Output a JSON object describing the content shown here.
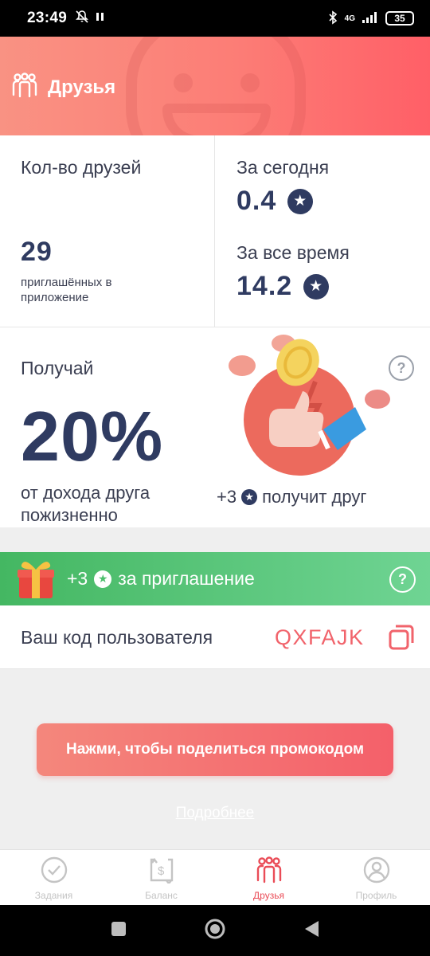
{
  "status_bar": {
    "time": "23:49",
    "network": "4G",
    "battery": "35"
  },
  "header": {
    "title": "Друзья"
  },
  "stats": {
    "friends_label": "Кол-во друзей",
    "friends_count": "29",
    "friends_note": "приглашённых в приложение",
    "today_label": "За сегодня",
    "today_value": "0.4",
    "alltime_label": "За все время",
    "alltime_value": "14.2"
  },
  "earn": {
    "label": "Получай",
    "percent": "20%",
    "desc": "от дохода друга пожизненно",
    "friend_bonus_prefix": "+3",
    "friend_bonus_suffix": "получит друг"
  },
  "invite": {
    "prefix": "+3",
    "suffix": "за приглашение"
  },
  "code": {
    "label": "Ваш код пользователя",
    "value": "QXFAJK"
  },
  "share_button": "Нажми, чтобы поделиться промокодом",
  "more_link": "Подробнее",
  "nav": [
    {
      "label": "Задания",
      "icon": "check-circle-icon"
    },
    {
      "label": "Баланс",
      "icon": "balance-icon"
    },
    {
      "label": "Друзья",
      "icon": "friends-icon",
      "active": true
    },
    {
      "label": "Профиль",
      "icon": "profile-icon"
    }
  ],
  "colors": {
    "accent": "#ea4c57",
    "header_from": "#f99283",
    "header_to": "#ff5f67",
    "green": "#44b762",
    "navy": "#2f3b61"
  }
}
